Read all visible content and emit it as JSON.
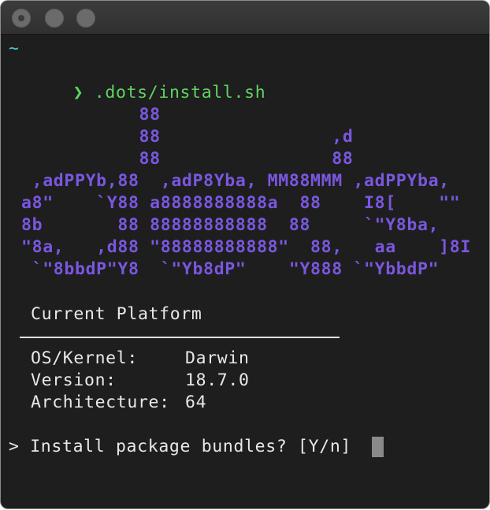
{
  "window": {
    "controls": [
      "close-button",
      "minimize-button",
      "maximize-button"
    ]
  },
  "terminal": {
    "cwd": "~",
    "prompt_symbol": "❯",
    "command": ".dots/install.sh",
    "ascii_art": [
      "           88",
      "           88                ,d",
      "           88                88",
      " ,adPPYb,88  ,adP8Yba, MM88MMM ,adPPYba,",
      "a8\"    `Y88 a8888888888a  88    I8[    \"\"",
      "8b       88 88888888888  88     `\"Y8ba,",
      "\"8a,   ,d88 \"88888888888\"  88,   aa    ]8I",
      " `\"8bbdP\"Y8  `\"Yb8dP\"    \"Y888 `\"YbbdP\""
    ],
    "platform_heading": "Current Platform",
    "platform_rows": [
      {
        "label": "OS/Kernel:",
        "value": "Darwin"
      },
      {
        "label": "Version:",
        "value": "18.7.0"
      },
      {
        "label": "Architecture:",
        "value": "64"
      }
    ],
    "input_prompt": "> Install package bundles? [Y/n] "
  }
}
